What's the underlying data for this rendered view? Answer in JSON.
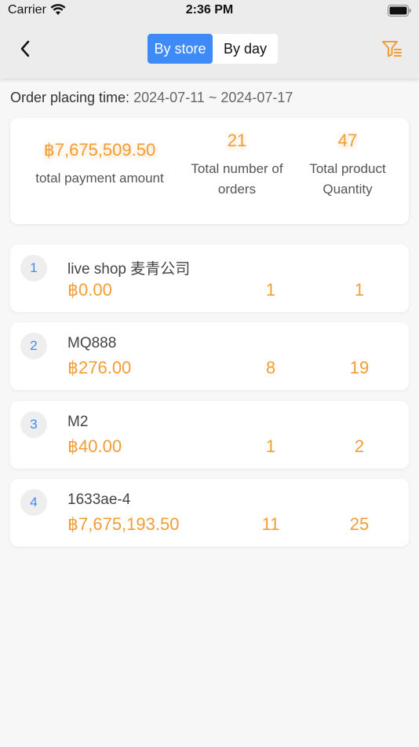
{
  "status_bar": {
    "carrier": "Carrier",
    "time": "2:36 PM"
  },
  "header": {
    "tabs": [
      {
        "label": "By store",
        "active": true
      },
      {
        "label": "By day",
        "active": false
      }
    ],
    "accent_color": "#3e8af7",
    "filter_color": "#f29d36"
  },
  "order_time": {
    "label": "Order placing time:",
    "range": "2024-07-11 ~ 2024-07-17"
  },
  "summary": {
    "total_payment": {
      "value": "฿7,675,509.50",
      "label": "total payment amount"
    },
    "total_orders": {
      "value": "21",
      "label_line1": "Total number of",
      "label_line2": "orders"
    },
    "total_qty": {
      "value": "47",
      "label_line1": "Total product",
      "label_line2": "Quantity"
    }
  },
  "stores": [
    {
      "rank": "1",
      "name": "live shop 麦青公司",
      "amount": "฿0.00",
      "orders": "1",
      "qty": "1"
    },
    {
      "rank": "2",
      "name": "MQ888",
      "amount": "฿276.00",
      "orders": "8",
      "qty": "19"
    },
    {
      "rank": "3",
      "name": "M2",
      "amount": "฿40.00",
      "orders": "1",
      "qty": "2"
    },
    {
      "rank": "4",
      "name": "1633ae-4",
      "amount": "฿7,675,193.50",
      "orders": "11",
      "qty": "25"
    }
  ]
}
